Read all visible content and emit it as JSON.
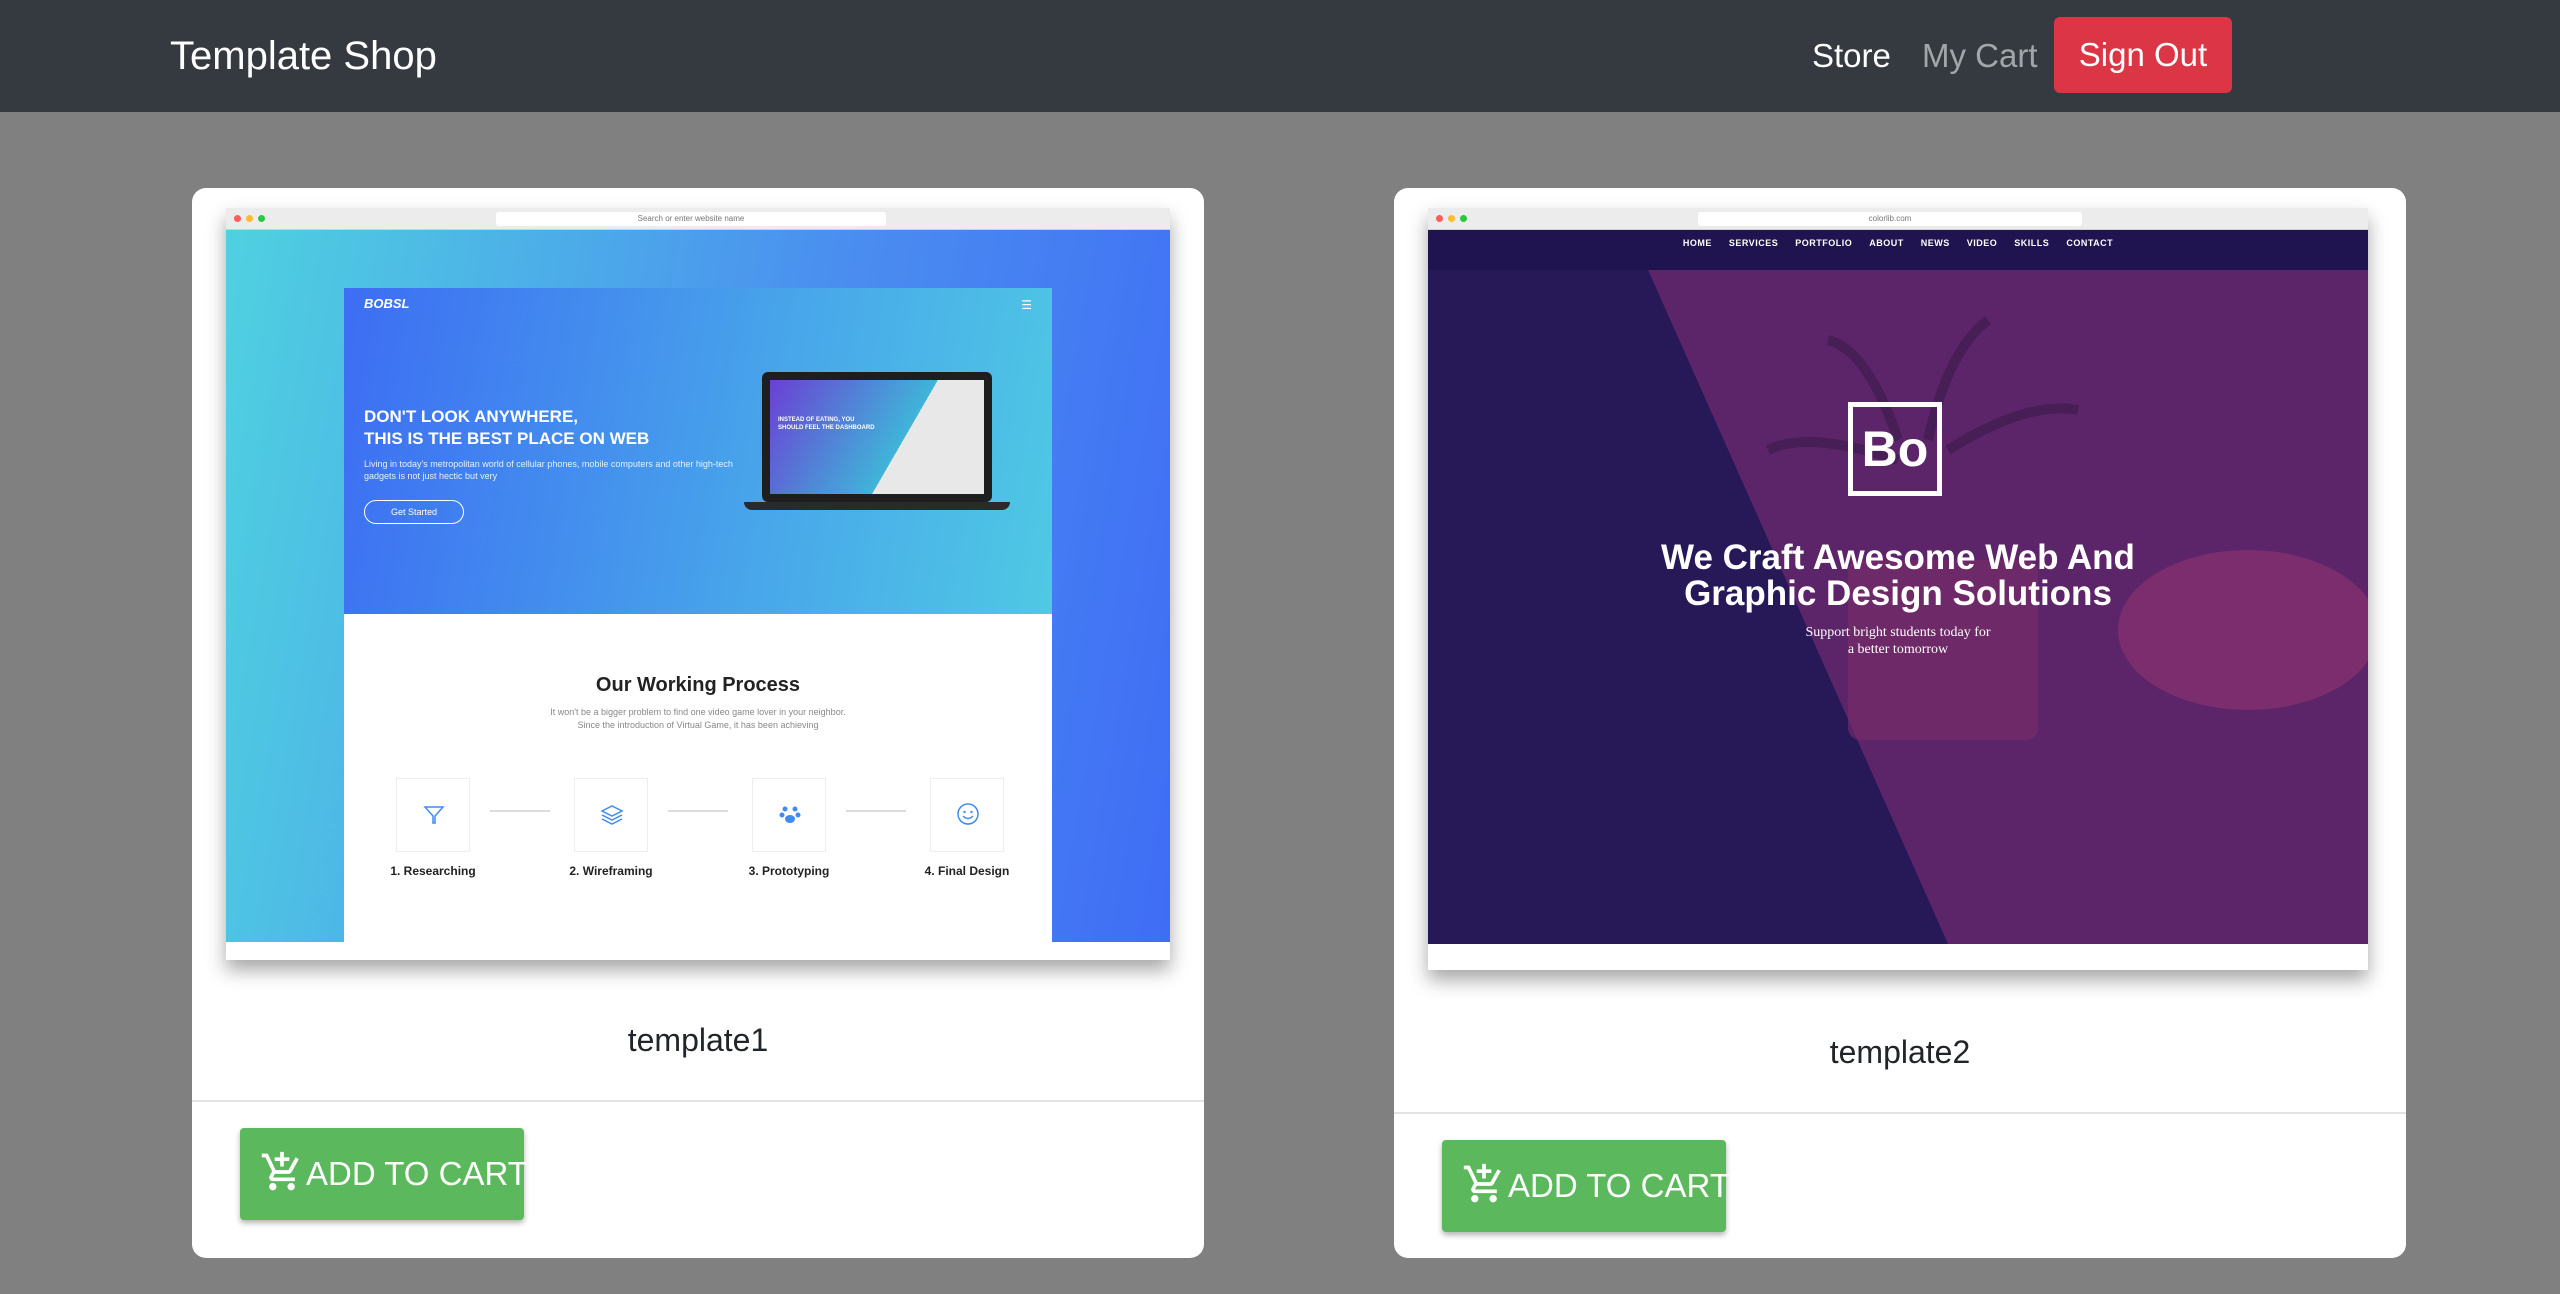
{
  "navbar": {
    "brand": "Template Shop",
    "links": {
      "store": "Store",
      "cart": "My Cart",
      "signout": "Sign Out"
    }
  },
  "products": [
    {
      "title": "template1",
      "button": "ADD TO CART",
      "preview": {
        "url": "Search or enter website name",
        "logo": "BOBSL",
        "headline_1": "DON'T LOOK ANYWHERE,",
        "headline_2": "THIS IS THE BEST PLACE ON WEB",
        "subtext": "Living in today's metropolitan world of cellular phones, mobile computers and other high-tech gadgets is not just hectic but very",
        "cta": "Get Started",
        "laptop_text": "INSTEAD OF EATING, YOU SHOULD FEEL THE DASHBOARD",
        "section_title": "Our Working Process",
        "section_text_1": "It won't be a bigger problem to find one video game lover in your neighbor.",
        "section_text_2": "Since the introduction of Virtual Game, it has been achieving",
        "steps": [
          "1. Researching",
          "2. Wireframing",
          "3. Prototyping",
          "4. Final Design"
        ]
      }
    },
    {
      "title": "template2",
      "button": "ADD TO CART",
      "preview": {
        "url": "colorlib.com",
        "nav": [
          "HOME",
          "SERVICES",
          "PORTFOLIO",
          "ABOUT",
          "NEWS",
          "VIDEO",
          "SKILLS",
          "CONTACT"
        ],
        "logo": "Bo",
        "headline_1": "We Craft Awesome Web And",
        "headline_2": "Graphic Design Solutions",
        "sub_1": "Support bright students today for",
        "sub_2": "a better tomorrow"
      }
    }
  ],
  "colors": {
    "navbar": "#343a40",
    "page_bg": "#808080",
    "signout": "#dc3545",
    "add_to_cart": "#5cb85c"
  },
  "icons": {
    "cart": "add-shopping-cart-icon",
    "menu": "hamburger-icon"
  }
}
